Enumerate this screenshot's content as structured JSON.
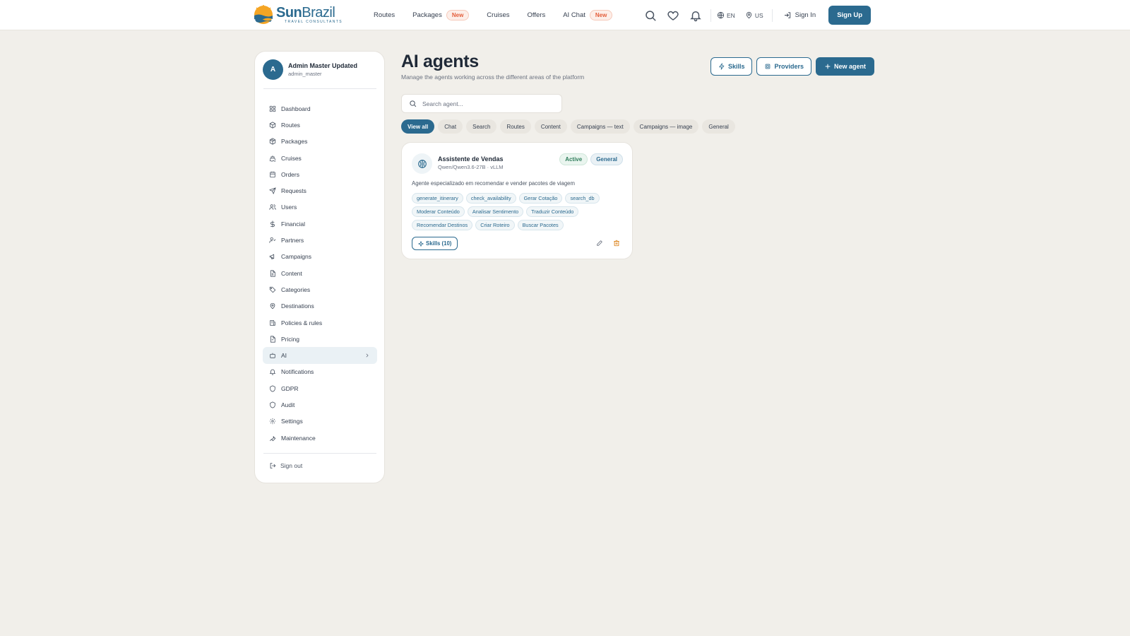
{
  "brand": {
    "name_part1": "Sun",
    "name_part2": "Brazil",
    "tagline": "TRAVEL CONSULTANTS"
  },
  "topnav": {
    "links": [
      {
        "label": "Routes"
      },
      {
        "label": "Packages",
        "badge": "New"
      },
      {
        "label": "Cruises"
      },
      {
        "label": "Offers"
      },
      {
        "label": "AI Chat",
        "badge": "New"
      }
    ],
    "language": "EN",
    "region": "US",
    "signin_label": "Sign In",
    "signup_label": "Sign Up"
  },
  "user": {
    "initial": "A",
    "name": "Admin Master Updated",
    "username": "admin_master"
  },
  "sidebar": {
    "items": [
      {
        "label": "Dashboard",
        "icon": "dashboard-icon"
      },
      {
        "label": "Routes",
        "icon": "routes-icon"
      },
      {
        "label": "Packages",
        "icon": "package-icon"
      },
      {
        "label": "Cruises",
        "icon": "ship-icon"
      },
      {
        "label": "Orders",
        "icon": "orders-icon"
      },
      {
        "label": "Requests",
        "icon": "send-icon"
      },
      {
        "label": "Users",
        "icon": "users-icon"
      },
      {
        "label": "Financial",
        "icon": "dollar-icon"
      },
      {
        "label": "Partners",
        "icon": "handshake-icon"
      },
      {
        "label": "Campaigns",
        "icon": "megaphone-icon"
      },
      {
        "label": "Content",
        "icon": "file-icon"
      },
      {
        "label": "Categories",
        "icon": "tag-icon"
      },
      {
        "label": "Destinations",
        "icon": "map-pin-icon"
      },
      {
        "label": "Policies & rules",
        "icon": "scale-icon"
      },
      {
        "label": "Pricing",
        "icon": "receipt-icon"
      },
      {
        "label": "AI",
        "icon": "bot-icon",
        "active": true
      },
      {
        "label": "Notifications",
        "icon": "bell-icon"
      },
      {
        "label": "GDPR",
        "icon": "shield-icon"
      },
      {
        "label": "Audit",
        "icon": "shield-check-icon"
      },
      {
        "label": "Settings",
        "icon": "gear-icon"
      },
      {
        "label": "Maintenance",
        "icon": "wrench-icon"
      }
    ],
    "signout_label": "Sign out"
  },
  "page": {
    "title": "AI agents",
    "subtitle": "Manage the agents working across the different areas of the platform",
    "actions": {
      "skills_label": "Skills",
      "providers_label": "Providers",
      "new_agent_label": "New agent"
    },
    "search": {
      "placeholder": "Search agent...",
      "value": ""
    },
    "filters": [
      {
        "label": "View all",
        "active": true
      },
      {
        "label": "Chat"
      },
      {
        "label": "Search"
      },
      {
        "label": "Routes"
      },
      {
        "label": "Content"
      },
      {
        "label": "Campaigns — text"
      },
      {
        "label": "Campaigns — image"
      },
      {
        "label": "General"
      }
    ]
  },
  "agents": [
    {
      "name": "Assistente de Vendas",
      "model": "Qwen/Qwen3.6-27B · vLLM",
      "status": "Active",
      "category": "General",
      "description": "Agente especializado em recomendar e vender pacotes de viagem",
      "tools": [
        "generate_itinerary",
        "check_availability",
        "Gerar Cotação",
        "search_db",
        "Moderar Conteúdo",
        "Analisar Sentimento",
        "Traduzir Conteúdo",
        "Recomendar Destinos",
        "Criar Roteiro",
        "Buscar Pacotes"
      ],
      "skills_label": "Skills (10)"
    }
  ],
  "colors": {
    "primary": "#2b6a8f",
    "background": "#f1efea",
    "badge_new": "#e35d3a",
    "status_active": "#2f7d5b",
    "delete_icon": "#d97706"
  }
}
